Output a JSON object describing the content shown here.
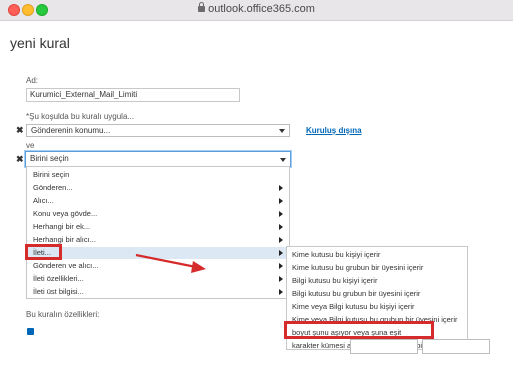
{
  "browser": {
    "url": "outlook.office365.com"
  },
  "page": {
    "title": "yeni kural"
  },
  "form": {
    "name_label": "Ad:",
    "name_value": "Kurumici_External_Mail_Limiti",
    "condition_label": "*Şu koşulda bu kuralı uygula...",
    "condition_value": "Gönderenin konumu...",
    "condition_link": "Kuruluş dışına",
    "and_label": "ve",
    "second_condition_value": "Birini seçin",
    "properties_label": "Bu kuralın özellikleri:"
  },
  "dropdown": {
    "items": [
      {
        "label": "Birini seçin",
        "submenu": false
      },
      {
        "label": "Gönderen...",
        "submenu": true
      },
      {
        "label": "Alıcı...",
        "submenu": true
      },
      {
        "label": "Konu veya gövde...",
        "submenu": true
      },
      {
        "label": "Herhangi bir ek...",
        "submenu": true
      },
      {
        "label": "Herhangi bir alıcı...",
        "submenu": true
      },
      {
        "label": "İleti...",
        "submenu": true
      },
      {
        "label": "Gönderen ve alıcı...",
        "submenu": true
      },
      {
        "label": "İleti özellikleri...",
        "submenu": true
      },
      {
        "label": "İleti üst bilgisi...",
        "submenu": true
      }
    ]
  },
  "submenu": {
    "items": [
      "Kime kutusu bu kişiyi içerir",
      "Kime kutusu bu grubun bir üyesini içerir",
      "Bilgi kutusu bu kişiyi içerir",
      "Bilgi kutusu bu grubun bir üyesini içerir",
      "Kime veya Bilgi kutusu bu kişiyi içerir",
      "Kime veya Bilgi kutusu bu grubun bir üyesini içerir",
      "boyut şunu aşıyor veya şuna eşit",
      "karakter kümesi adı bu sözcüklerden birini içeriyor"
    ]
  },
  "colors": {
    "accent": "#0067b8",
    "highlight": "#d52b2b"
  }
}
